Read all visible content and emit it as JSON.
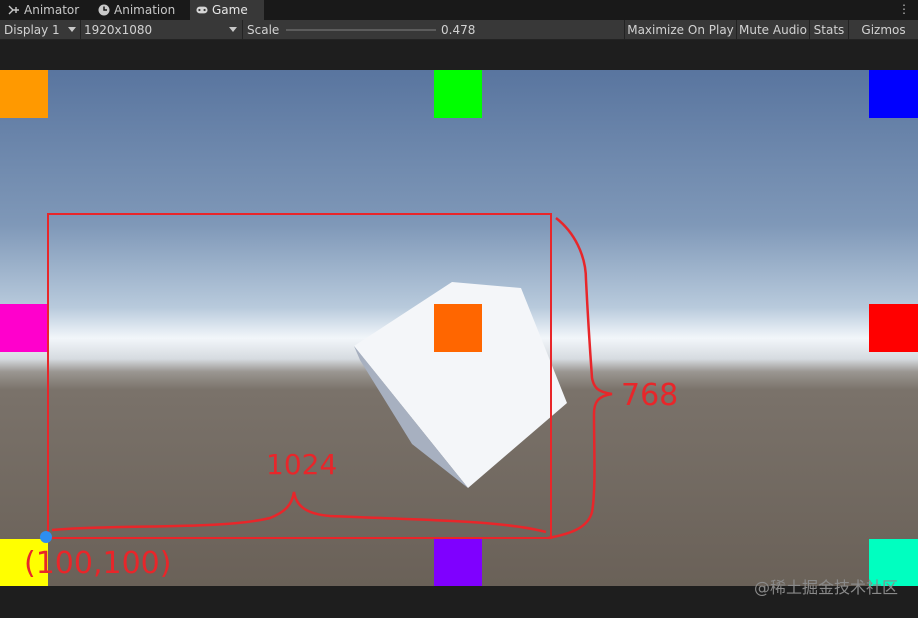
{
  "tabs": [
    {
      "label": "Animator",
      "icon": "animator-icon"
    },
    {
      "label": "Animation",
      "icon": "clock-icon"
    },
    {
      "label": "Game",
      "icon": "gamepad-icon"
    }
  ],
  "toolbar": {
    "display": "Display 1",
    "resolution": "1920x1080",
    "scale_label": "Scale",
    "scale_value": "0.478",
    "maximize": "Maximize On Play",
    "mute": "Mute Audio",
    "stats": "Stats",
    "gizmos": "Gizmos"
  },
  "annotations": {
    "width": "1024",
    "height": "768",
    "origin": "(100,100)"
  },
  "watermark": "@稀土掘金技术社区",
  "colors": {
    "orange": "#ff9900",
    "green": "#00ff00",
    "blue": "#0000ff",
    "magenta": "#ff00cc",
    "red": "#ff0000",
    "yellow": "#ffff00",
    "purple": "#7f00ff",
    "teal": "#00ffc0",
    "cube_face": "#ff6600",
    "annotation": "#e8262a"
  }
}
